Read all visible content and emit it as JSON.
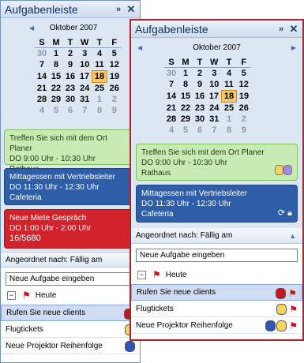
{
  "app": {
    "title": "Aufgabenleiste",
    "expand_icon": "»",
    "close_icon": "✕"
  },
  "calendar": {
    "month": "Oktober 2007",
    "prev_icon": "◀",
    "next_icon": "▶",
    "weekdays": [
      "S",
      "M",
      "T",
      "W",
      "T",
      "F"
    ],
    "weeks": [
      [
        "30",
        "1",
        "2",
        "3",
        "4",
        "5"
      ],
      [
        "7",
        "8",
        "9",
        "10",
        "11",
        "12"
      ],
      [
        "14",
        "15",
        "16",
        "17",
        "18",
        "19"
      ],
      [
        "21",
        "22",
        "23",
        "24",
        "25",
        "26"
      ],
      [
        "28",
        "29",
        "30",
        "31",
        "1",
        "2"
      ],
      [
        "4",
        "5",
        "6",
        "7",
        "8",
        "9"
      ]
    ],
    "today": "18"
  },
  "appointments": [
    {
      "title": "Treffen Sie sich mit dem Ort Planer",
      "time": "DO 9:00 Uhr - 10:30 Uhr",
      "location": "Rathaus",
      "color": "#c8eab3"
    },
    {
      "title": "Mittagessen mit Vertriebsleiter",
      "time": "DO 11:30 Uhr - 12:30 Uhr",
      "location": "Cafeteria",
      "color": "#2f5ea9"
    },
    {
      "title": "Neue Miete Gespräch",
      "time": "DO 1:00 Uhr - 2:00 Uhr",
      "location": "16/5680",
      "color": "#d2232c"
    }
  ],
  "tasks": {
    "sort_label": "Angeordnet nach: Fällig am",
    "new_task": "Neue Aufgabe eingeben",
    "group_label": "Heute",
    "items": [
      {
        "label": "Rufen Sie neue clients"
      },
      {
        "label": "Flugtickets"
      },
      {
        "label": "Neue Projektor Reihenfolge"
      }
    ]
  },
  "icons": {
    "flag": "flag-icon",
    "recurrence": "recurrence-icon",
    "lock": "lock-icon",
    "expander": "collapse-icon"
  },
  "colors": {
    "accent_border": "#b52328",
    "today_highlight": "#f9c764"
  }
}
